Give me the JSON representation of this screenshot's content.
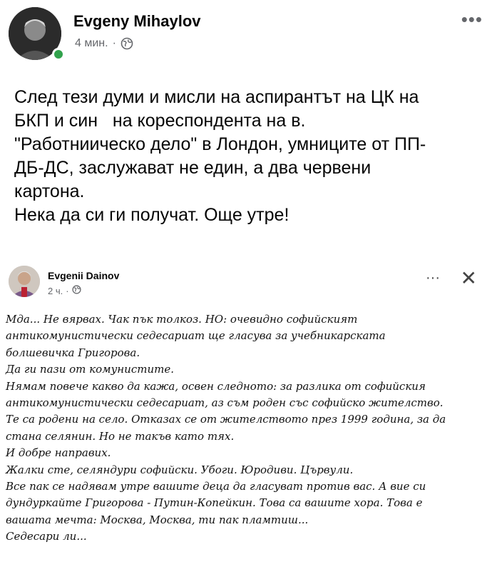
{
  "post": {
    "author": "Evgeny Mihaylov",
    "time": "4 мин.",
    "separator": "·",
    "more": "•••",
    "paragraphs": [
      "След тези думи и мисли на аспирантът на ЦК на",
      "БКП и син   на кореспондента на в.",
      "\"Работниическо дело\" в Лондон, умниците от ПП-",
      "ДБ-ДС, заслужават не един, а два червени",
      "картона.",
      "Нека да си ги получат. Още утре!"
    ]
  },
  "shared_post": {
    "author": "Evgenii Dainov",
    "time": "2 ч.",
    "separator": "·",
    "more": "···",
    "close": "✕",
    "lines": [
      "Мда... Не вярвах. Чак пък толкоз. НО: очевидно софийският",
      "антикомунистически седесариат ще гласува за учебникарската",
      "болшевичка Григорова.",
      "Да ги пази от комунистите.",
      "Нямам повече какво да кажа, освен следното: за разлика от софийския",
      "антикомунистически седесариат, аз съм роден със софийско жителство.",
      "Те са родени на село.  Отказах се от жителството през 1999 година, за да",
      "стана селянин. Но не такъв като тях.",
      "И добре направих.",
      "Жалки сте, селяндури софийски. Убоги. Юродиви. Цървули.",
      "Все пак се надявам утре вашите деца да гласуват против вас. А вие си",
      "дундуркайте Григорова - Путин-Копейкин. Това са вашите хора. Това е",
      "вашата мечта: Москва, Москва, ти пак пламтиш...",
      "Седесари ли..."
    ]
  },
  "icons": {
    "globe": "globe-icon",
    "more": "more-horizontal-icon",
    "close": "close-icon"
  },
  "colors": {
    "online": "#31a24c",
    "meta": "#65676b",
    "text": "#050505"
  }
}
